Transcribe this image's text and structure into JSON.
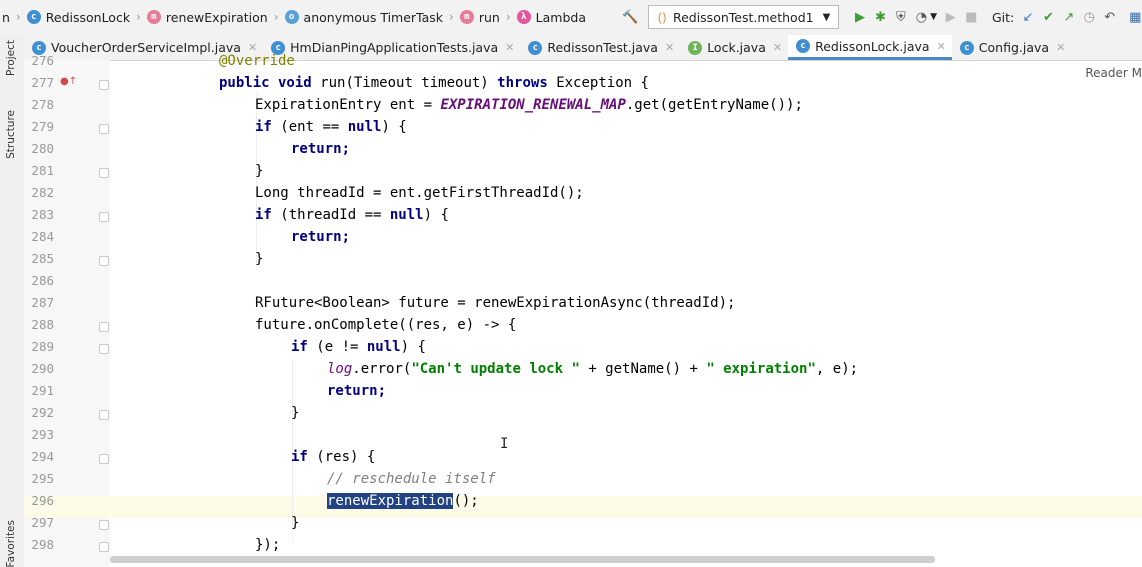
{
  "navbar": {
    "crumbs": [
      {
        "label": "n",
        "icon": "none"
      },
      {
        "label": "RedissonLock",
        "icon": "class-icon"
      },
      {
        "label": "renewExpiration",
        "icon": "method-icon"
      },
      {
        "label": "anonymous TimerTask",
        "icon": "anonymous-class-icon"
      },
      {
        "label": "run",
        "icon": "method-icon"
      },
      {
        "label": "Lambda",
        "icon": "lambda-icon"
      }
    ],
    "run_config": "RedissonTest.method1",
    "git_label": "Git:"
  },
  "tabs": [
    {
      "label": "VoucherOrderServiceImpl.java",
      "icon": "class-icon",
      "active": false
    },
    {
      "label": "HmDianPingApplicationTests.java",
      "icon": "class-icon",
      "active": false
    },
    {
      "label": "RedissonTest.java",
      "icon": "class-icon",
      "active": false
    },
    {
      "label": "Lock.java",
      "icon": "interface-icon",
      "active": false
    },
    {
      "label": "RedissonLock.java",
      "icon": "class-icon",
      "active": true
    },
    {
      "label": "Config.java",
      "icon": "class-icon",
      "active": false
    }
  ],
  "side": {
    "project": "Project",
    "structure": "Structure",
    "favorites": "Favorites"
  },
  "editor": {
    "reader_mode": "Reader M",
    "lines": [
      {
        "n": "276",
        "text": "@Override"
      },
      {
        "n": "277",
        "text": "public void run(Timeout timeout) throws Exception {"
      },
      {
        "n": "278",
        "text": "ExpirationEntry ent = EXPIRATION_RENEWAL_MAP.get(getEntryName());"
      },
      {
        "n": "279",
        "text": "if (ent == null) {"
      },
      {
        "n": "280",
        "text": "return;"
      },
      {
        "n": "281",
        "text": "}"
      },
      {
        "n": "282",
        "text": "Long threadId = ent.getFirstThreadId();"
      },
      {
        "n": "283",
        "text": "if (threadId == null) {"
      },
      {
        "n": "284",
        "text": "return;"
      },
      {
        "n": "285",
        "text": "}"
      },
      {
        "n": "286",
        "text": ""
      },
      {
        "n": "287",
        "text": "RFuture<Boolean> future = renewExpirationAsync(threadId);"
      },
      {
        "n": "288",
        "text": "future.onComplete((res, e) -> {"
      },
      {
        "n": "289",
        "text": "if (e != null) {"
      },
      {
        "n": "290",
        "text": "log.error(\"Can't update lock \" + getName() + \" expiration\", e);"
      },
      {
        "n": "291",
        "text": "return;"
      },
      {
        "n": "292",
        "text": "}"
      },
      {
        "n": "293",
        "text": ""
      },
      {
        "n": "294",
        "text": "if (res) {"
      },
      {
        "n": "295",
        "text": "// reschedule itself"
      },
      {
        "n": "296",
        "text": "renewExpiration();"
      },
      {
        "n": "297",
        "text": "}"
      },
      {
        "n": "298",
        "text": "});"
      }
    ]
  },
  "colors": {
    "keyword": "#000080",
    "string": "#008000",
    "field": "#660e7a",
    "comment": "#808080",
    "selection": "#214283"
  }
}
